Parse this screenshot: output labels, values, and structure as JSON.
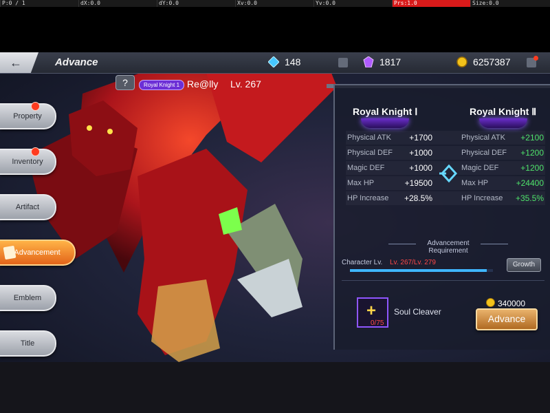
{
  "debug": {
    "p": "P:0 / 1",
    "dx": "dX:0.0",
    "dy": "dY:0.0",
    "xv": "Xv:0.0",
    "yv": "Yv:0.0",
    "prs": "Prs:1.0",
    "size": "Size:0.0"
  },
  "header": {
    "title": "Advance",
    "back_icon": "back-arrow-icon",
    "currencies": [
      {
        "icon": "diamond-icon",
        "value": "148"
      },
      {
        "icon": "purple-crystal-icon",
        "value": "1817"
      },
      {
        "icon": "gold-coin-icon",
        "value": "6257387"
      }
    ]
  },
  "player": {
    "rank_badge": "Royal Knight 1",
    "name": "Re@lly",
    "level": "Lv. 267"
  },
  "nav": {
    "items": [
      {
        "label": "Property",
        "badge": true
      },
      {
        "label": "Inventory",
        "badge": true
      },
      {
        "label": "Artifact",
        "badge": false
      },
      {
        "label": "Advancement",
        "badge": false,
        "active": true
      },
      {
        "label": "Emblem",
        "badge": false
      },
      {
        "label": "Title",
        "badge": false
      }
    ]
  },
  "advance": {
    "current_rank": "Royal Knight Ⅰ",
    "next_rank": "Royal Knight Ⅱ",
    "stats": [
      {
        "label": "Physical ATK",
        "current": "+1700",
        "next": "+2100"
      },
      {
        "label": "Physical DEF",
        "current": "+1000",
        "next": "+1200"
      },
      {
        "label": "Magic DEF",
        "current": "+1000",
        "next": "+1200"
      },
      {
        "label": "Max HP",
        "current": "+19500",
        "next": "+24400"
      },
      {
        "label": "HP Increase",
        "current": "+28.5%",
        "next": "+35.5%"
      }
    ],
    "requirement_title": "Advancement Requirement",
    "char_lv_label": "Character Lv.",
    "char_lv_value": "Lv. 267/Lv. 279",
    "char_lv_progress": 0.957,
    "growth_label": "Growth",
    "item_name": "Soul Cleaver",
    "item_count": "0/75",
    "cost": "340000",
    "advance_label": "Advance"
  },
  "colors": {
    "accent_green": "#4fe36b",
    "warning_red": "#ff4848",
    "active_tab": "#e3641a"
  }
}
